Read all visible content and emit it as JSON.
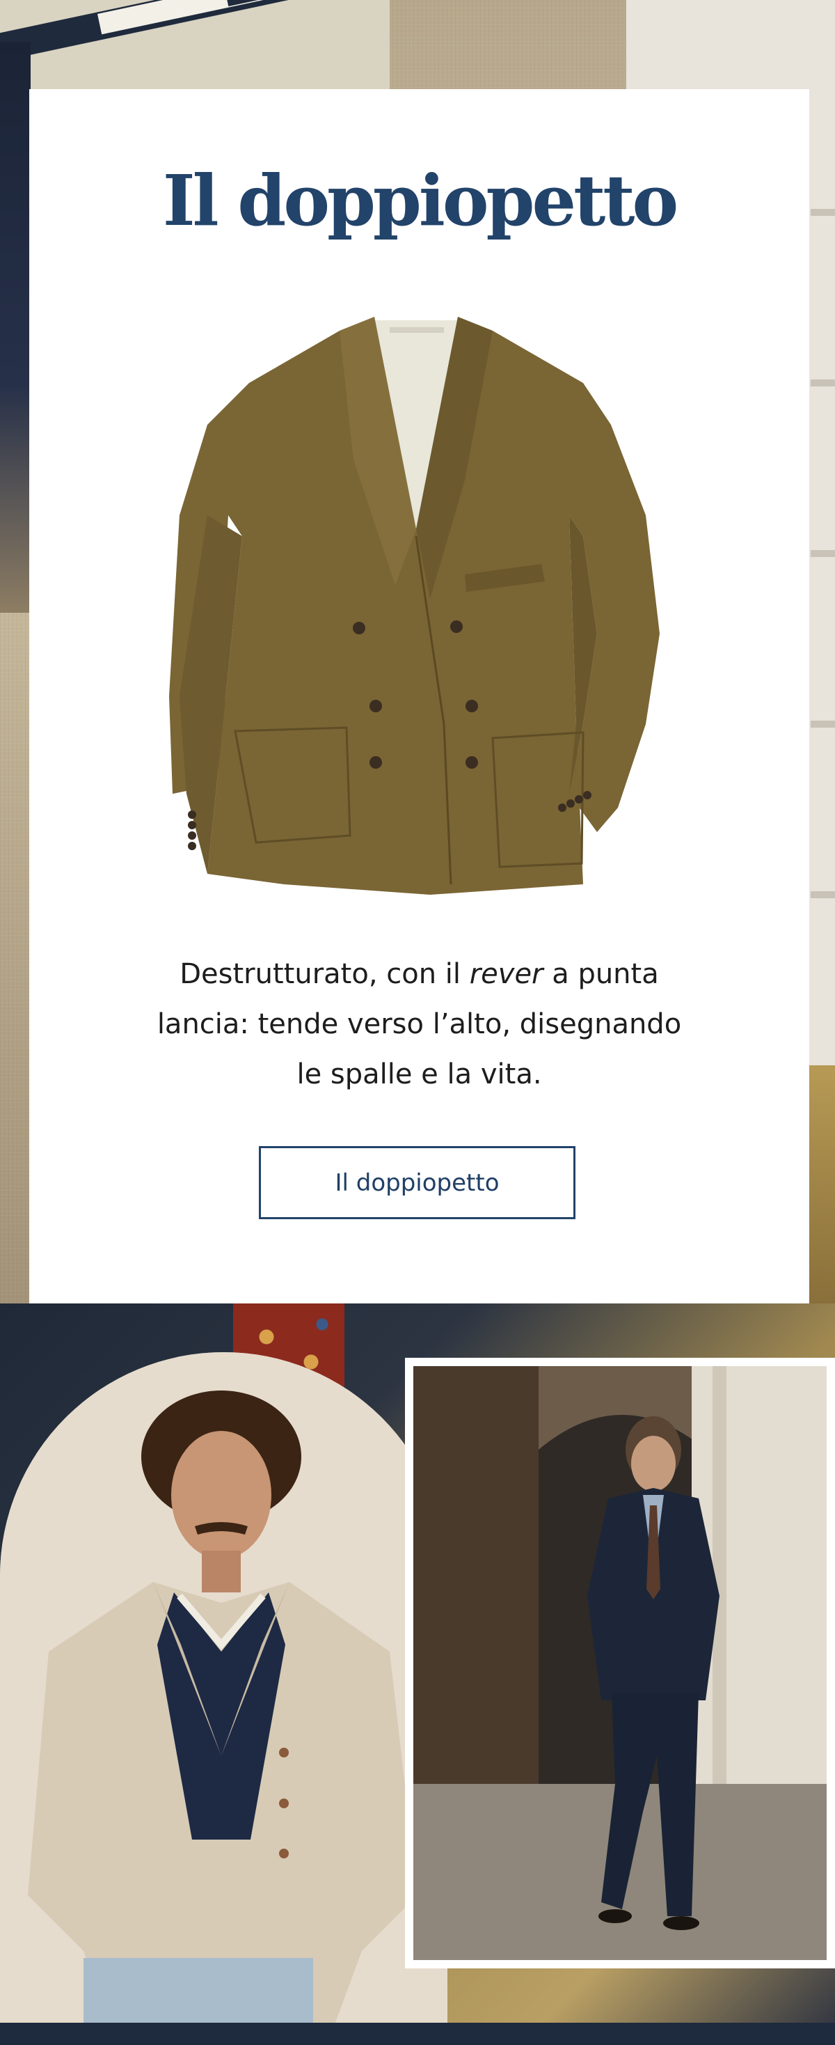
{
  "card": {
    "title": "Il doppiopetto",
    "description_before": "Destrutturato, con il ",
    "description_emphasis": "rever",
    "description_after": " a punta lancia: tende verso l’alto, disegnando le spalle e la vita.",
    "button_label": "Il doppiopetto",
    "jacket_image": "double-breasted-olive-jacket"
  },
  "photos": {
    "left": "man-in-beige-double-breasted-jacket",
    "right": "man-in-navy-double-breasted-suit-street"
  },
  "colors": {
    "title": "#22436a",
    "button_border": "#22436a",
    "jacket": "#7a6534",
    "card_bg": "#ffffff"
  }
}
